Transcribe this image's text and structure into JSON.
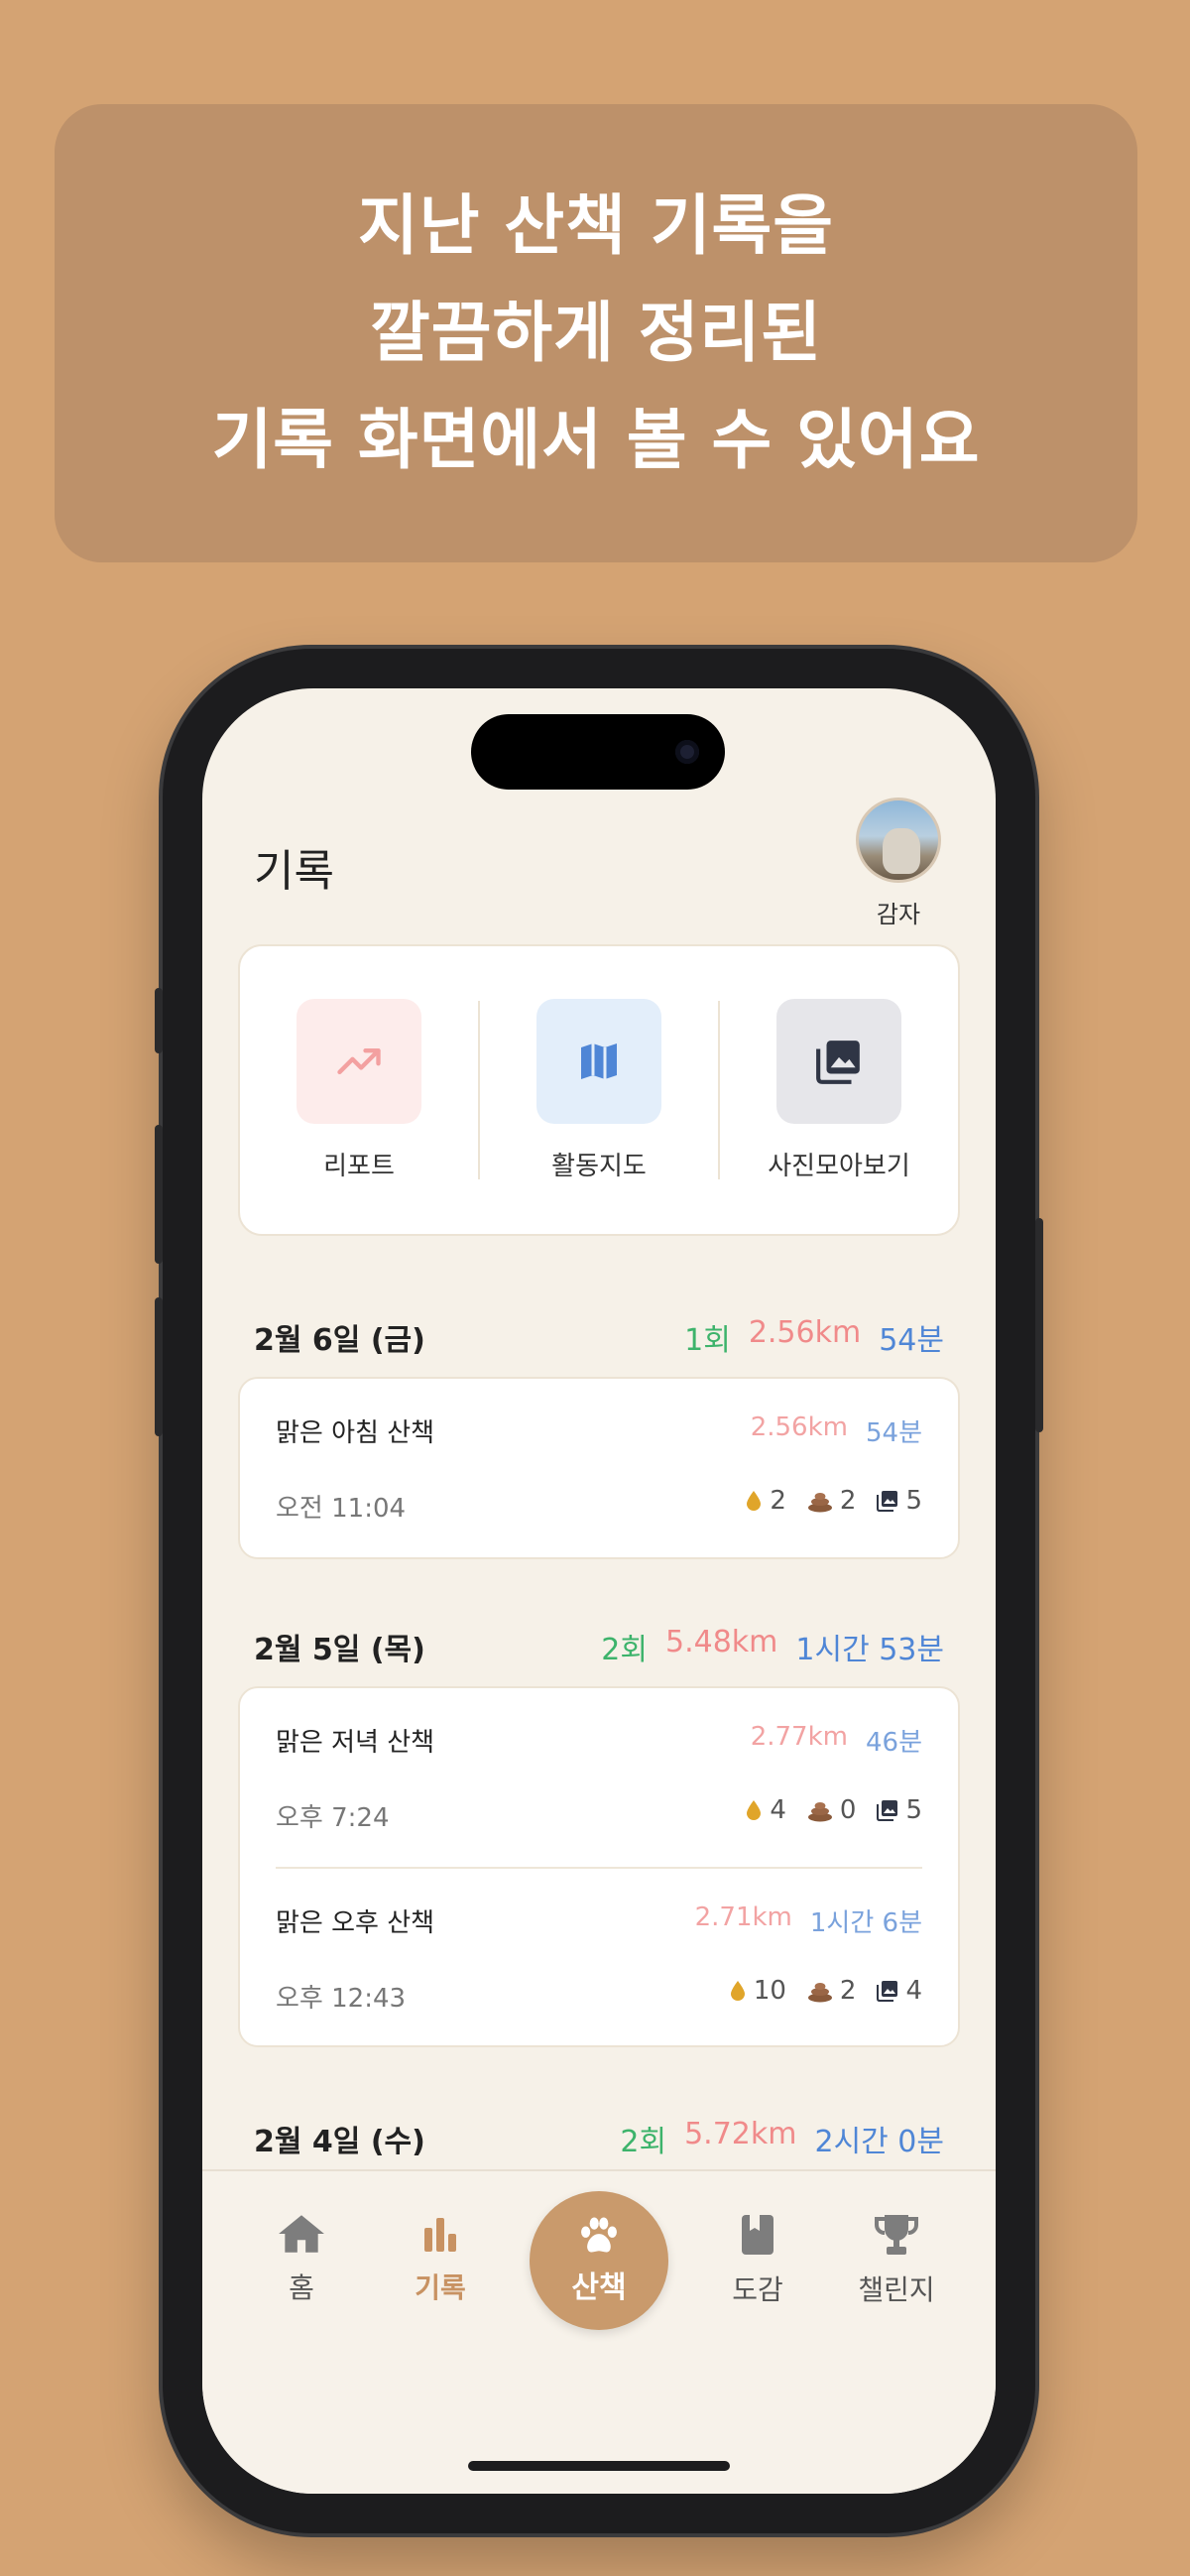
{
  "banner": {
    "line1": "지난 산책 기록을",
    "line2": "깔끔하게 정리된",
    "line3": "기록 화면에서 볼 수 있어요"
  },
  "header": {
    "title": "기록",
    "profile_name": "감자"
  },
  "quick_actions": [
    {
      "label": "리포트",
      "icon": "trend-chart-icon",
      "bg": "#fdeceb",
      "color": "#f3a0a0"
    },
    {
      "label": "활동지도",
      "icon": "map-icon",
      "bg": "#e3eefa",
      "color": "#4f86d6"
    },
    {
      "label": "사진모아보기",
      "icon": "photo-library-icon",
      "bg": "#e6e6ea",
      "color": "#2f3545"
    }
  ],
  "days": [
    {
      "date": "2월 6일 (금)",
      "count": "1회",
      "distance": "2.56km",
      "duration": "54분",
      "walks": [
        {
          "name": "맑은 아침 산책",
          "distance": "2.56km",
          "duration": "54분",
          "time": "오전 11:04",
          "pee": "2",
          "poop": "2",
          "photos": "5"
        }
      ]
    },
    {
      "date": "2월 5일 (목)",
      "count": "2회",
      "distance": "5.48km",
      "duration": "1시간 53분",
      "walks": [
        {
          "name": "맑은 저녁 산책",
          "distance": "2.77km",
          "duration": "46분",
          "time": "오후 7:24",
          "pee": "4",
          "poop": "0",
          "photos": "5"
        },
        {
          "name": "맑은 오후 산책",
          "distance": "2.71km",
          "duration": "1시간 6분",
          "time": "오후 12:43",
          "pee": "10",
          "poop": "2",
          "photos": "4"
        }
      ]
    },
    {
      "date": "2월 4일 (수)",
      "count": "2회",
      "distance": "5.72km",
      "duration": "2시간 0분",
      "walks": []
    }
  ],
  "tabbar": {
    "home": "홈",
    "records": "기록",
    "walk": "산책",
    "dex": "도감",
    "challenge": "챌린지"
  },
  "colors": {
    "background": "#d4a373",
    "accent": "#c99a6c",
    "count": "#3db36b",
    "distance": "#f08a8a",
    "duration": "#4f86d6"
  }
}
